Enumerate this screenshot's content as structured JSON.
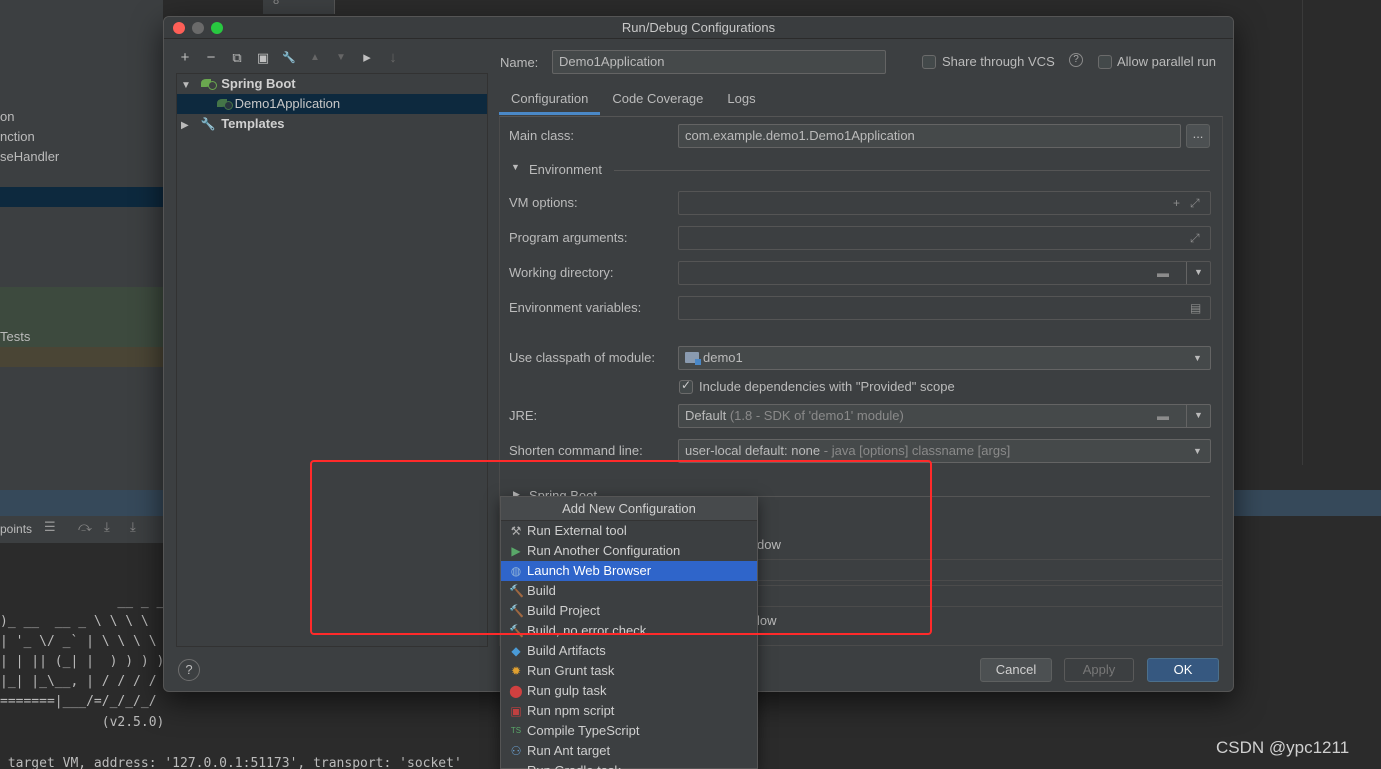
{
  "background": {
    "project_items": [
      "on",
      "nction",
      "seHandler",
      "Tests"
    ],
    "debug_label": "points",
    "console_lines": [
      "               __ _ _",
      ")_ __  __ _ \\ \\ \\ \\",
      "| '_ \\/ _` | \\ \\ \\ \\",
      "| | || (_| |  ) ) ) )",
      "|_| |_\\__, | / / / /",
      "=======|___/=/_/_/_/",
      "             (v2.5.0)",
      " target VM, address: '127.0.0.1:51173', transport: 'socket'"
    ],
    "tab_stub": "8"
  },
  "watermark": "CSDN @ypc1211",
  "dialog": {
    "title": "Run/Debug Configurations",
    "toolbar": [
      "+",
      "−",
      "⧉",
      "▣",
      "🔧",
      "▲",
      "▼",
      "▸",
      "↓"
    ],
    "tree": {
      "spring_boot": "Spring Boot",
      "app": "Demo1Application",
      "templates": "Templates"
    },
    "help": "?",
    "name_label": "Name:",
    "name_value": "Demo1Application",
    "share_vcs": "Share through VCS",
    "allow_parallel": "Allow parallel run",
    "tabs": [
      "Configuration",
      "Code Coverage",
      "Logs"
    ],
    "main_class_label": "Main class:",
    "main_class_value": "com.example.demo1.Demo1Application",
    "browse": "...",
    "environment": "Environment",
    "vm_options": "VM options:",
    "program_args": "Program arguments:",
    "working_dir": "Working directory:",
    "env_vars": "Environment variables:",
    "classpath_label": "Use classpath of module:",
    "classpath_value": "demo1",
    "include_deps": "Include dependencies with \"Provided\" scope",
    "jre_label": "JRE:",
    "jre_value": "Default",
    "jre_detail": " (1.8 - SDK of 'demo1' module)",
    "shorten_label": "Shorten command line:",
    "shorten_value": "user-local default: none",
    "shorten_detail": " - java [options] classname [args]",
    "spring_boot_section": "Spring Boot",
    "behind_text_1": "dow",
    "behind_text_2": "low",
    "cancel": "Cancel",
    "apply": "Apply",
    "ok": "OK"
  },
  "popup": {
    "title": "Add New Configuration",
    "items": [
      {
        "label": "Run External tool",
        "icon": "⚒",
        "color": "#b0b0b0"
      },
      {
        "label": "Run Another Configuration",
        "icon": "▶",
        "color": "#59a869"
      },
      {
        "label": "Launch Web Browser",
        "icon": "◍",
        "color": "#8fb3d9"
      },
      {
        "label": "Build",
        "icon": "🔨",
        "color": "#59a869"
      },
      {
        "label": "Build Project",
        "icon": "🔨",
        "color": "#59a869"
      },
      {
        "label": "Build, no error check",
        "icon": "🔨",
        "color": "#59a869"
      },
      {
        "label": "Build Artifacts",
        "icon": "◆",
        "color": "#4a9bd7"
      },
      {
        "label": "Run Grunt task",
        "icon": "✹",
        "color": "#e0a030"
      },
      {
        "label": "Run gulp task",
        "icon": "⬤",
        "color": "#d04040"
      },
      {
        "label": "Run npm script",
        "icon": "▣",
        "color": "#c04040"
      },
      {
        "label": "Compile TypeScript",
        "icon": "TS",
        "color": "#59a869"
      },
      {
        "label": "Run Ant target",
        "icon": "⚇",
        "color": "#6a9fd0"
      },
      {
        "label": "Run Gradle task",
        "icon": "◐",
        "color": "#8a8a8a"
      }
    ],
    "selected_index": 2
  }
}
